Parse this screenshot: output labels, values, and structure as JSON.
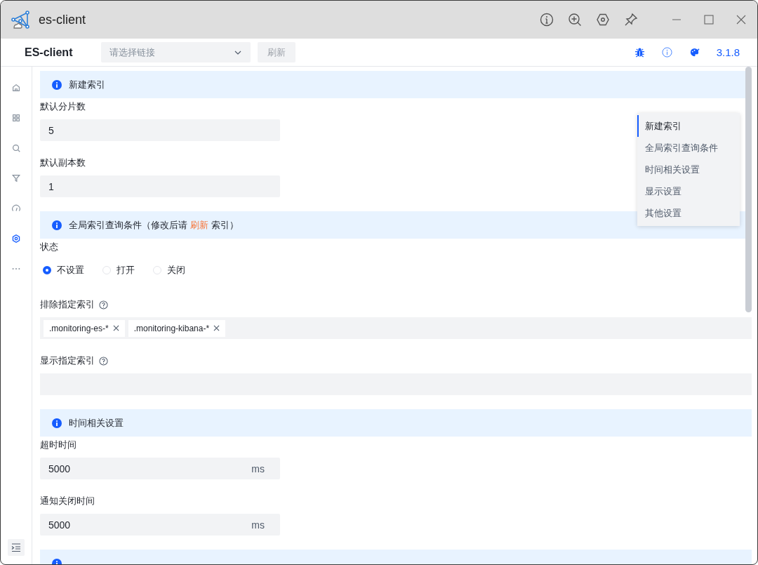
{
  "window": {
    "title": "es-client"
  },
  "toolbar": {
    "brand": "ES-client",
    "connection_select": {
      "placeholder": "请选择链接"
    },
    "refresh_button": {
      "label": "刷新",
      "disabled": true
    },
    "version": "3.1.8"
  },
  "sidebar": {
    "items": [
      {
        "selected": false
      },
      {
        "selected": false
      },
      {
        "selected": false
      },
      {
        "selected": false
      },
      {
        "selected": false
      },
      {
        "selected": true
      },
      {
        "selected": false
      }
    ]
  },
  "sections": [
    {
      "kind": "header",
      "title": "新建索引"
    },
    {
      "kind": "field",
      "label": "默认分片数",
      "value": "5"
    },
    {
      "kind": "field",
      "label": "默认副本数",
      "value": "1"
    },
    {
      "kind": "header",
      "title": "全局索引查询条件（修改后请",
      "link": "刷新",
      "title_after": "索引）"
    },
    {
      "kind": "radio",
      "label": "状态",
      "options": [
        {
          "label": "不设置",
          "selected": true
        },
        {
          "label": "打开",
          "selected": false
        },
        {
          "label": "关闭",
          "selected": false
        }
      ]
    },
    {
      "kind": "tags",
      "label": "排除指定索引",
      "help": true,
      "tags": [
        ".monitoring-es-*",
        ".monitoring-kibana-*"
      ]
    },
    {
      "kind": "tags",
      "label": "显示指定索引",
      "help": true
    },
    {
      "kind": "header",
      "title": "时间相关设置"
    },
    {
      "kind": "field",
      "label": "超时时间",
      "value": "5000",
      "suffix": "ms"
    },
    {
      "kind": "field",
      "label": "通知关闭时间",
      "value": "5000",
      "suffix": "ms"
    },
    {
      "kind": "header"
    }
  ],
  "anchor_menu": {
    "items": [
      {
        "label": "新建索引",
        "selected": true
      },
      {
        "label": "全局索引查询条件",
        "selected": false
      },
      {
        "label": "时间相关设置",
        "selected": false
      },
      {
        "label": "显示设置",
        "selected": false
      },
      {
        "label": "其他设置",
        "selected": false
      }
    ]
  }
}
